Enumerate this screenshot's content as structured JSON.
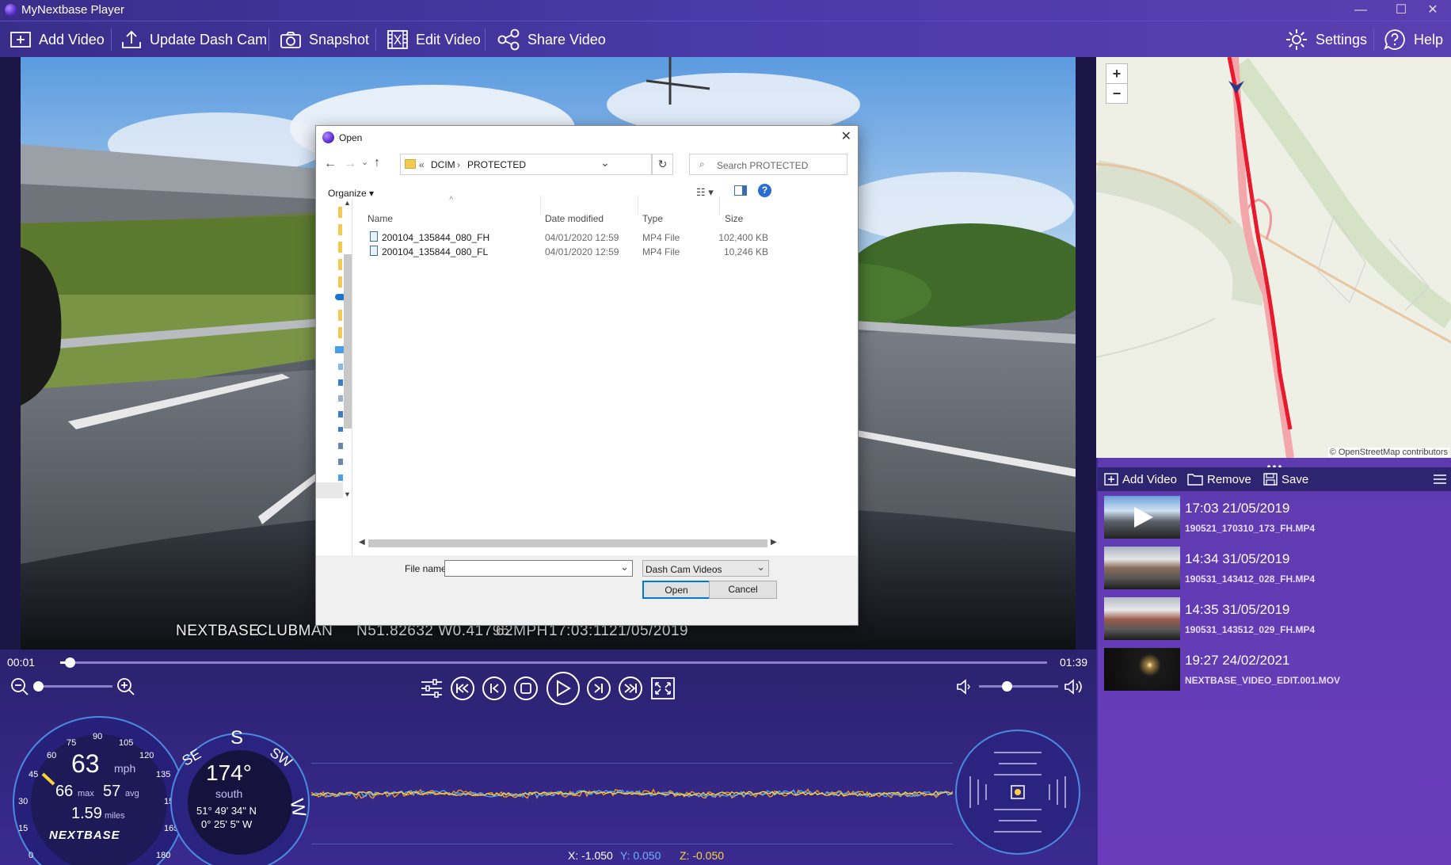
{
  "window": {
    "title": "MyNextbase Player",
    "minimize": "—",
    "maximize": "☐",
    "close": "✕"
  },
  "toolbar": {
    "add_video": "Add Video",
    "update_dash_cam": "Update Dash Cam",
    "snapshot": "Snapshot",
    "edit_video": "Edit Video",
    "share_video": "Share Video",
    "settings": "Settings",
    "help": "Help"
  },
  "video": {
    "overlay_brand": "NEXTBASE",
    "overlay_model": "CLUBMAN",
    "overlay_gps": "N51.82632  W0.41795",
    "overlay_speed": "62MPH",
    "overlay_time": "17:03:11",
    "overlay_date": "21/05/2019"
  },
  "map": {
    "zoom_in": "+",
    "zoom_out": "−",
    "attribution": "© OpenStreetMap contributors"
  },
  "playlist": {
    "add_video": "Add Video",
    "remove": "Remove",
    "save": "Save",
    "items": [
      {
        "time": "17:03 21/05/2019",
        "file": "190521_170310_173_FH.MP4"
      },
      {
        "time": "14:34 31/05/2019",
        "file": "190531_143412_028_FH.MP4"
      },
      {
        "time": "14:35 31/05/2019",
        "file": "190531_143512_029_FH.MP4"
      },
      {
        "time": "19:27 24/02/2021",
        "file": "NEXTBASE_VIDEO_EDIT.001.MOV"
      }
    ]
  },
  "playback": {
    "current_time": "00:01",
    "duration": "01:39",
    "progress_fraction": 0.01,
    "zoom_level_fraction": 0.0,
    "volume_fraction": 0.35
  },
  "speedometer": {
    "speed": "63",
    "unit": "mph",
    "max": "66",
    "max_label": "max",
    "avg": "57",
    "avg_label": "avg",
    "distance": "1.59",
    "distance_label": "miles",
    "ticks": [
      "0",
      "15",
      "30",
      "45",
      "60",
      "75",
      "90",
      "105",
      "120",
      "135",
      "150",
      "165",
      "180"
    ],
    "brand": "NEXTBASE"
  },
  "compass": {
    "heading": "174°",
    "direction": "south",
    "lat": "51° 49' 34\" N",
    "lon": "0° 25' 5\" W",
    "labels": [
      "SE",
      "S",
      "SW",
      "W"
    ]
  },
  "gsensor": {
    "x_label": "X: -1.050",
    "y_label": "Y: 0.050",
    "z_label": "Z: -0.050"
  },
  "dialog": {
    "title": "Open",
    "path_prefix": "«",
    "path": [
      "DCIM",
      "PROTECTED"
    ],
    "search_placeholder": "Search PROTECTED",
    "organize": "Organize",
    "columns": [
      "Name",
      "Date modified",
      "Type",
      "Size"
    ],
    "files": [
      {
        "name": "200104_135844_080_FH",
        "date": "04/01/2020 12:59",
        "type": "MP4 File",
        "size": "102,400 KB"
      },
      {
        "name": "200104_135844_080_FL",
        "date": "04/01/2020 12:59",
        "type": "MP4 File",
        "size": "10,246 KB"
      }
    ],
    "file_name_label": "File name:",
    "file_name_value": "",
    "filter": "Dash Cam Videos",
    "open": "Open",
    "cancel": "Cancel"
  },
  "colors": {
    "accent": "#4a3aa8",
    "route": "#e8192c",
    "speed_needle": "#ffd23a",
    "gsensor_x": "#f0a020",
    "gsensor_y": "#4aa8ff",
    "gsensor_z": "#ffd23a"
  }
}
